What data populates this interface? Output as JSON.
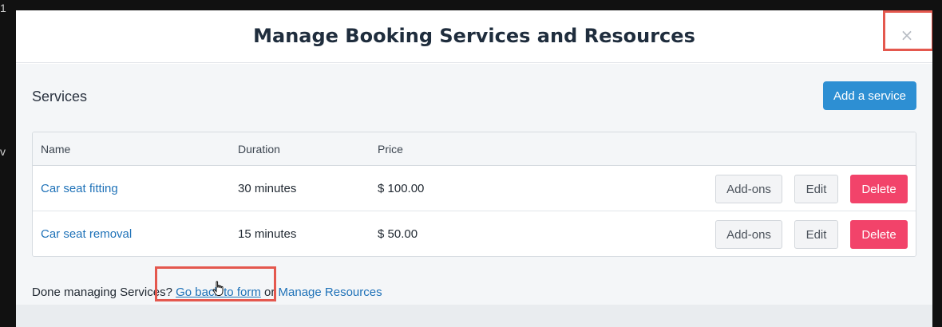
{
  "modal": {
    "title": "Manage Booking Services and Resources",
    "close_icon": "close-icon",
    "close_label": "×"
  },
  "services": {
    "section_title": "Services",
    "add_button_label": "Add a service",
    "columns": [
      "Name",
      "Duration",
      "Price"
    ],
    "rows": [
      {
        "name": "Car seat fitting",
        "duration": "30 minutes",
        "price": "$ 100.00",
        "addons_label": "Add-ons",
        "edit_label": "Edit",
        "delete_label": "Delete"
      },
      {
        "name": "Car seat removal",
        "duration": "15 minutes",
        "price": "$ 50.00",
        "addons_label": "Add-ons",
        "edit_label": "Edit",
        "delete_label": "Delete"
      }
    ]
  },
  "footer": {
    "prefix": "Done managing Services?",
    "back_link": "Go back to form",
    "or_text": "or",
    "resources_link": "Manage Resources"
  },
  "colors": {
    "primary": "#2d8fd3",
    "danger": "#f2436a",
    "link": "#1f72b8",
    "highlight": "#e4584e"
  },
  "icons": {
    "cursor": "hand-pointer-icon"
  }
}
